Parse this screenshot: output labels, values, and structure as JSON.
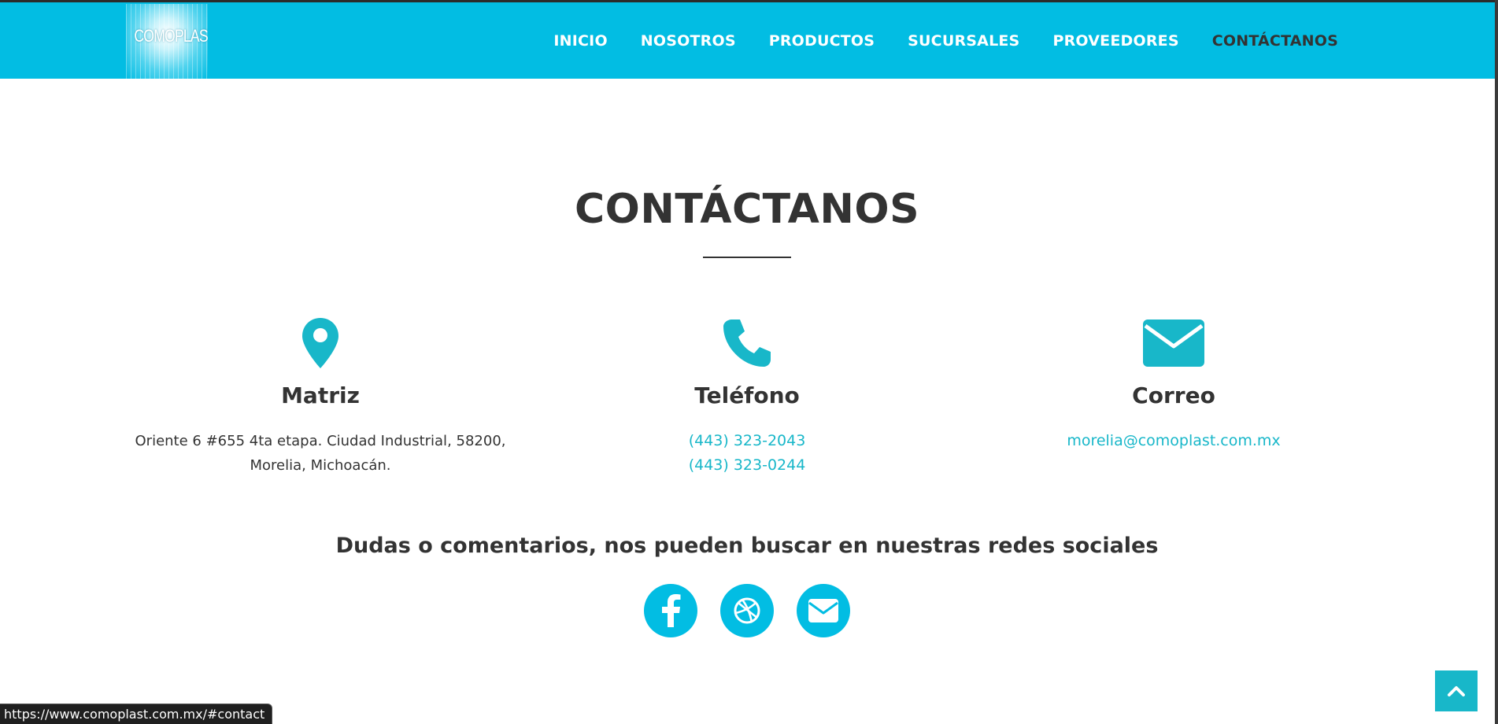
{
  "header": {
    "logo_text": "COMOPLAST",
    "nav": [
      {
        "label": "INICIO"
      },
      {
        "label": "NOSOTROS"
      },
      {
        "label": "PRODUCTOS"
      },
      {
        "label": "SUCURSALES"
      },
      {
        "label": "PROVEEDORES"
      },
      {
        "label": "CONTÁCTANOS",
        "active": true
      }
    ]
  },
  "main": {
    "title": "CONTÁCTANOS",
    "columns": [
      {
        "icon": "map-marker-icon",
        "heading": "Matriz",
        "lines": [
          "Oriente 6 #655 4ta etapa. Ciudad Industrial, 58200,",
          "Morelia, Michoacán."
        ]
      },
      {
        "icon": "phone-icon",
        "heading": "Teléfono",
        "lines": [
          "(443) 323-2043",
          "(443) 323-0244"
        ]
      },
      {
        "icon": "envelope-icon",
        "heading": "Correo",
        "lines": [
          "morelia@comoplast.com.mx"
        ]
      }
    ],
    "social": {
      "heading": "Dudas o comentarios, nos pueden buscar en nuestras redes sociales",
      "buttons": [
        "facebook-icon",
        "dribbble-icon",
        "envelope-icon"
      ]
    }
  },
  "status_bar": {
    "url": "https://www.comoplast.com.mx/#contact"
  },
  "colors": {
    "nav_bg": "#02bde3",
    "accent": "#18b7c9",
    "text": "#333333"
  }
}
